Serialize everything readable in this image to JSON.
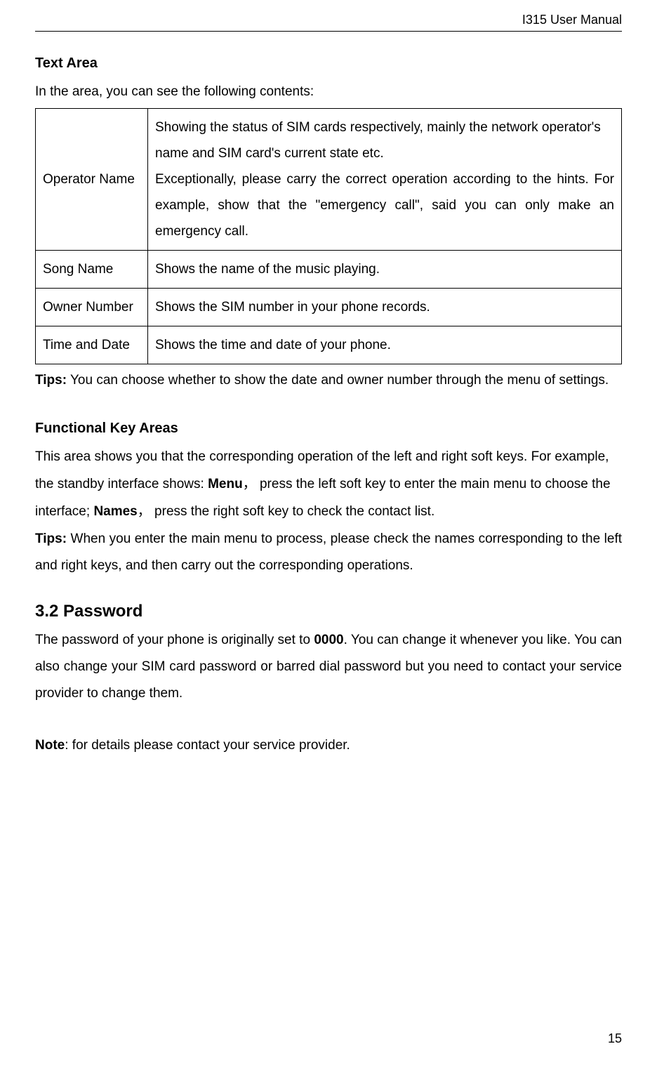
{
  "header": {
    "title": "I315 User Manual"
  },
  "sections": {
    "textArea": {
      "heading": "Text Area",
      "intro": "In the area, you can see the following contents:",
      "tableRows": [
        {
          "label": "Operator Name",
          "desc_p1": "Showing the status of SIM cards respectively, mainly the network operator's name and SIM card's current state etc.",
          "desc_p2": "Exceptionally, please carry the correct operation according to the hints. For example, show that the \"emergency call\", said you can only make an emergency call."
        },
        {
          "label": "Song Name",
          "desc": "Shows the name of the music playing."
        },
        {
          "label": "Owner Number",
          "desc": "Shows the SIM number in your phone records."
        },
        {
          "label": "Time and Date",
          "desc": "Shows the time and date of your phone."
        }
      ],
      "tipsLabel": "Tips:",
      "tipsText": " You can choose whether to show the date and owner number through the menu of settings."
    },
    "functionalKey": {
      "heading": "Functional Key Areas",
      "body_pre": "This area shows you that the corresponding operation of the left and right soft keys. For example, the standby interface shows: ",
      "menu_bold": "Menu",
      "body_mid1": "， press the left soft key to enter the main menu to choose the interface; ",
      "names_bold": "Names",
      "body_mid2": "，  press the right soft key to check the contact list.",
      "tipsLabel": "Tips:",
      "tipsText": " When you enter the main menu to process, please check the names corresponding to the left and right keys, and then carry out the corresponding operations."
    },
    "password": {
      "heading": "3.2 Password",
      "body_pre": "The password of your phone is originally set to ",
      "pwd_bold": "0000",
      "body_post": ". You can change it whenever you like. You can also change your SIM card password or barred dial password but you need to contact your service provider to change them.",
      "noteLabel": "Note",
      "noteText": ": for details please contact your service provider."
    }
  },
  "pageNumber": "15"
}
